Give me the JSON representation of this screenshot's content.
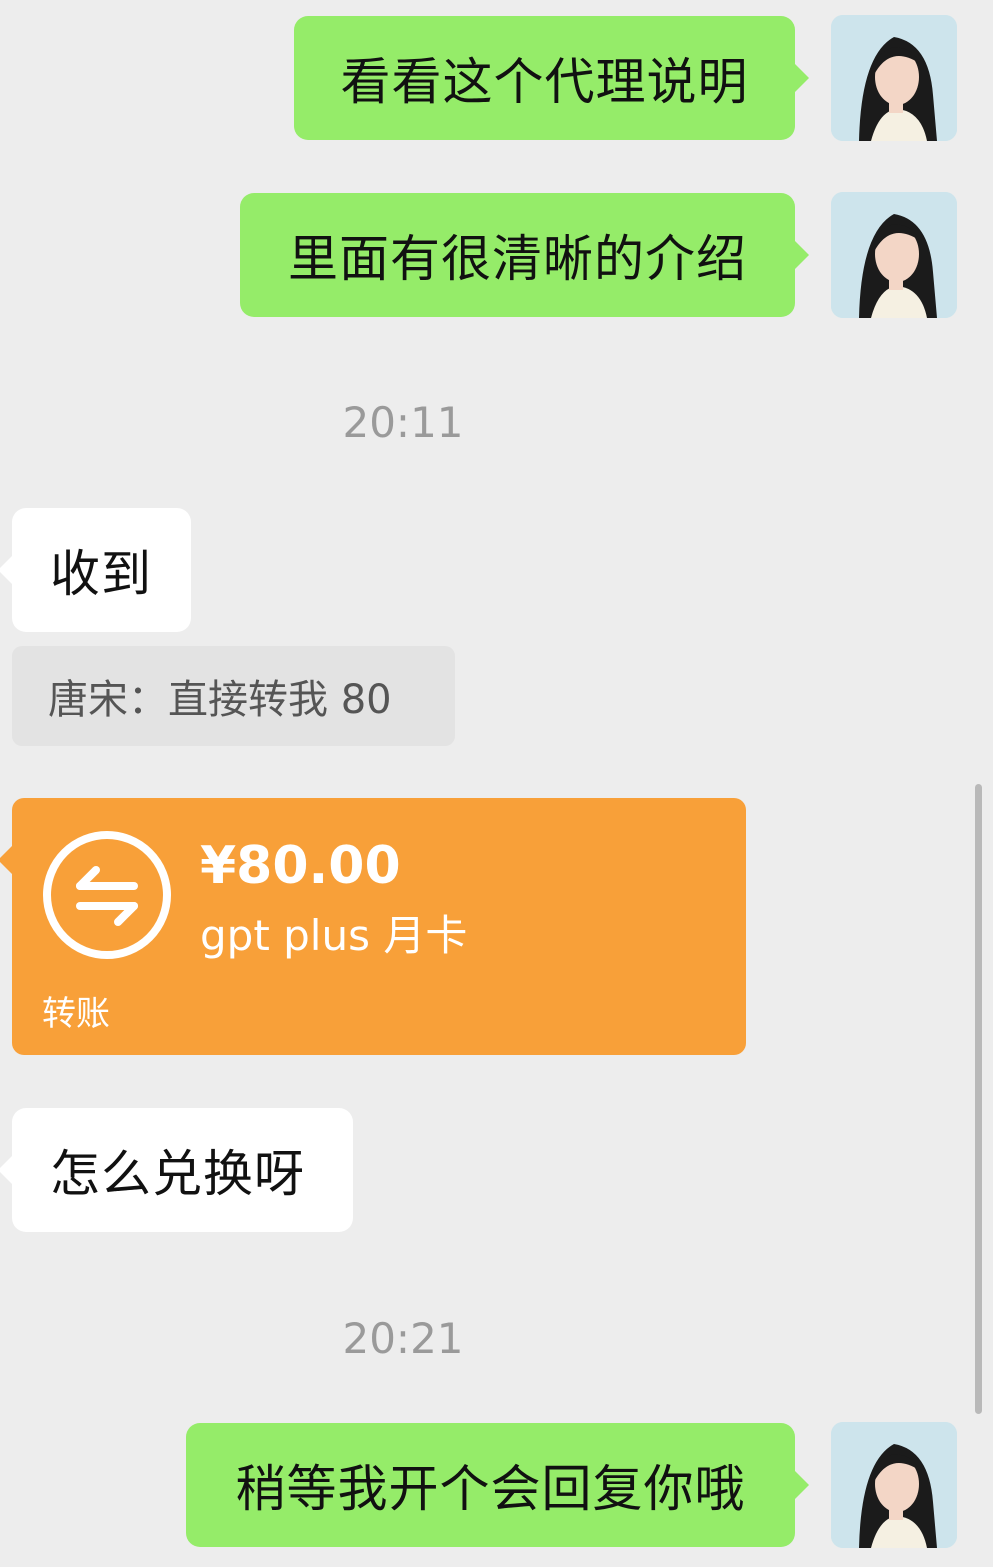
{
  "messages": [
    {
      "sender": "me",
      "text": "看看这个代理说明"
    },
    {
      "sender": "me",
      "text": "里面有很清晰的介绍"
    }
  ],
  "timestamps": [
    "20:11",
    "20:21"
  ],
  "received": {
    "first": "收到",
    "quote": "唐宋：直接转我 80",
    "second": "怎么兑换呀"
  },
  "transfer": {
    "amount": "¥80.00",
    "note": "gpt plus 月卡",
    "label": "转账",
    "icon": "transfer-arrows-icon"
  },
  "last_message": "稍等我开个会回复你哦",
  "colors": {
    "background": "#ededed",
    "my_bubble": "#95ec69",
    "their_bubble": "#ffffff",
    "transfer_card": "#f8a039",
    "timestamp": "#9a9a9a"
  }
}
